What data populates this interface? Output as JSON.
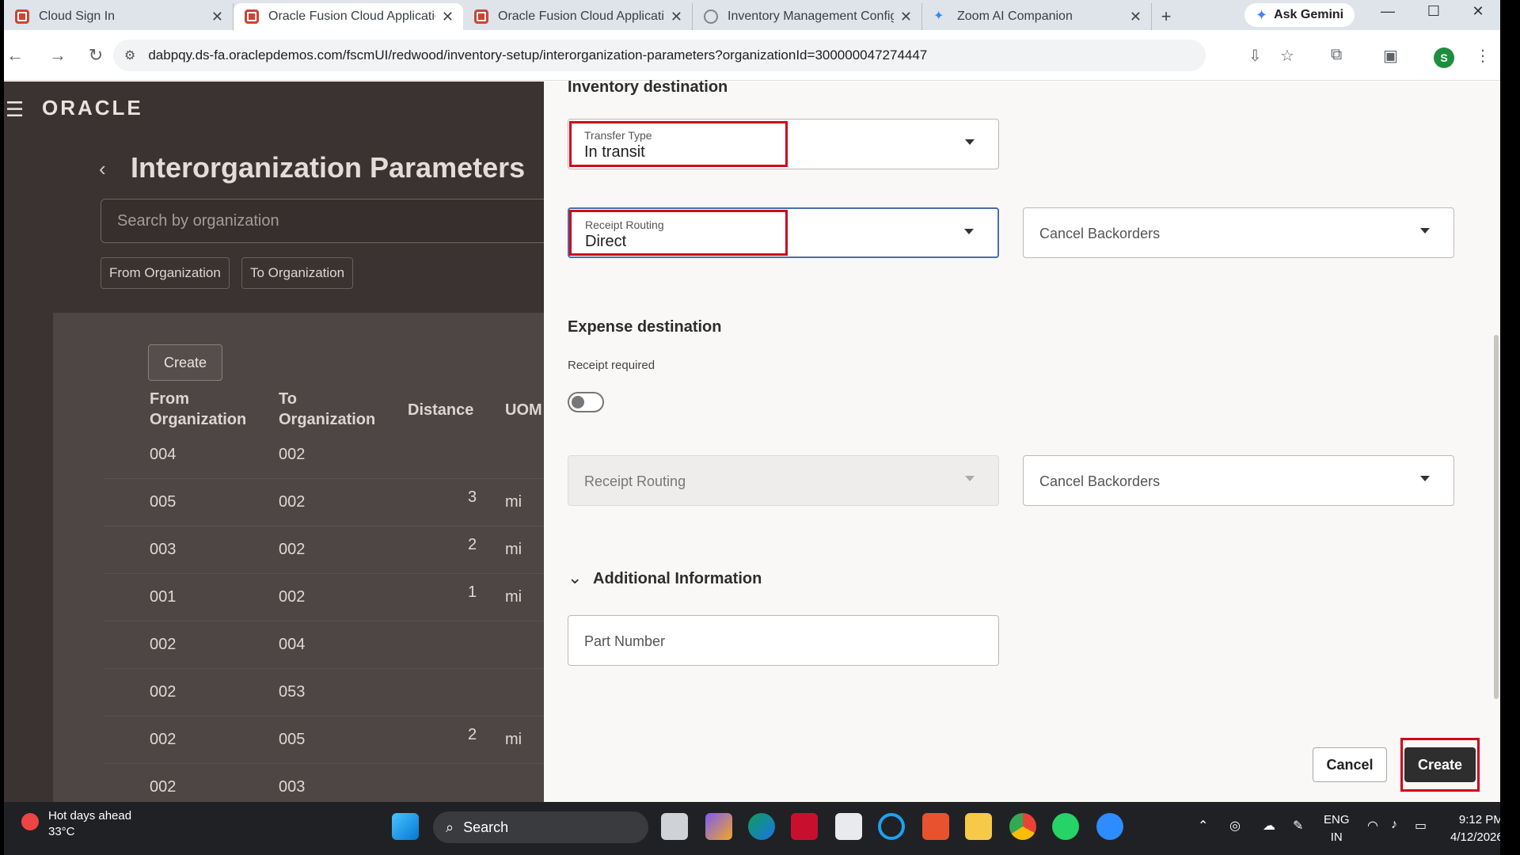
{
  "browser": {
    "tabs": [
      {
        "label": "Cloud Sign In",
        "active": false
      },
      {
        "label": "Oracle Fusion Cloud Applicatio",
        "active": true
      },
      {
        "label": "Oracle Fusion Cloud Applicatio",
        "active": false
      },
      {
        "label": "Inventory Management Config",
        "active": false
      },
      {
        "label": "Zoom AI Companion",
        "active": false
      }
    ],
    "new_tab": "+",
    "ask_gemini": "Ask Gemini",
    "url": "dabpqy.ds-fa.oraclepdemos.com/fscmUI/redwood/inventory-setup/interorganization-parameters?organizationId=300000047274447",
    "profile_initial": "S"
  },
  "app": {
    "logo": "ORACLE",
    "page_title": "Interorganization Parameters",
    "page_title_suffix": "/",
    "search_placeholder": "Search by organization",
    "filter_chips": [
      "From Organization",
      "To Organization"
    ],
    "create_label": "Create",
    "table": {
      "headers": [
        "From Organization",
        "To Organization",
        "Distance",
        "UOM"
      ],
      "rows": [
        {
          "from": "004",
          "to": "002",
          "distance": "",
          "uom": ""
        },
        {
          "from": "005",
          "to": "002",
          "distance": "3",
          "uom": "mi"
        },
        {
          "from": "003",
          "to": "002",
          "distance": "2",
          "uom": "mi"
        },
        {
          "from": "001",
          "to": "002",
          "distance": "1",
          "uom": "mi"
        },
        {
          "from": "002",
          "to": "004",
          "distance": "",
          "uom": ""
        },
        {
          "from": "002",
          "to": "053",
          "distance": "",
          "uom": ""
        },
        {
          "from": "002",
          "to": "005",
          "distance": "2",
          "uom": "mi"
        },
        {
          "from": "002",
          "to": "003",
          "distance": "",
          "uom": ""
        }
      ]
    }
  },
  "drawer": {
    "inventory_destination": {
      "heading": "Inventory destination",
      "transfer_type": {
        "label": "Transfer Type",
        "value": "In transit"
      },
      "receipt_routing": {
        "label": "Receipt Routing",
        "value": "Direct"
      },
      "cancel_backorders": {
        "placeholder": "Cancel Backorders"
      }
    },
    "expense_destination": {
      "heading": "Expense destination",
      "receipt_required_label": "Receipt required",
      "receipt_required_on": false,
      "receipt_routing": {
        "placeholder": "Receipt Routing"
      },
      "cancel_backorders": {
        "placeholder": "Cancel Backorders"
      }
    },
    "additional_information": {
      "heading": "Additional Information",
      "part_number": {
        "placeholder": "Part Number"
      }
    },
    "cancel_label": "Cancel",
    "create_label": "Create"
  },
  "taskbar": {
    "weather_title": "Hot days ahead",
    "weather_temp": "33°C",
    "search_label": "Search",
    "lang_1": "ENG",
    "lang_2": "IN",
    "time": "9:12 PM",
    "date": "4/12/2026"
  },
  "colors": {
    "highlight_red": "#d0021b",
    "oracle_red": "#c74634",
    "primary_button": "#2e2e2e"
  }
}
